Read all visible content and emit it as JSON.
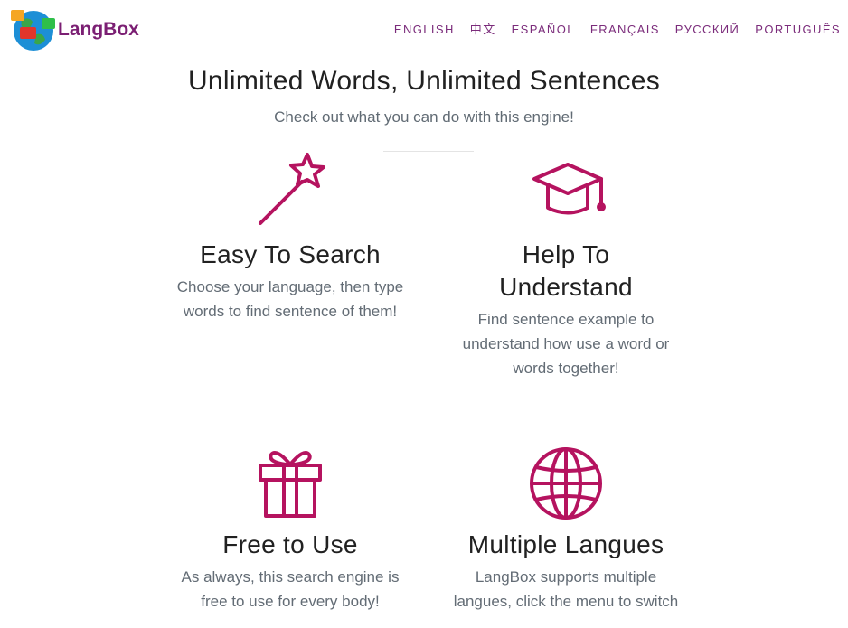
{
  "brand": {
    "name": "LangBox",
    "logo_icon": "globe-chat-bubbles-logo"
  },
  "nav": {
    "languages": [
      "ENGLISH",
      "中文",
      "ESPAÑOL",
      "FRANÇAIS",
      "РУССКИЙ",
      "PORTUGUÊS"
    ]
  },
  "section": {
    "title": "Unlimited Words, Unlimited Sentences",
    "subtitle": "Check out what you can do with this engine!"
  },
  "colors": {
    "accent": "#b5135f",
    "brand": "#7b1f73",
    "text": "#212121",
    "muted": "#636c75"
  },
  "features": [
    {
      "icon": "magic-wand-icon",
      "title": "Easy To Search",
      "text_lines": [
        "Choose your language, then type",
        "words to find sentence of them!"
      ]
    },
    {
      "icon": "graduation-cap-icon",
      "title_lines": [
        "Help To",
        "Understand"
      ],
      "text_lines": [
        "Find sentence example to",
        "understand how use a word or",
        "words together!"
      ]
    },
    {
      "icon": "gift-icon",
      "title": "Free to Use",
      "text_lines": [
        "As always, this search engine is",
        "free to use for every body!"
      ]
    },
    {
      "icon": "globe-icon",
      "title": "Multiple Langues",
      "text_lines": [
        "LangBox supports multiple",
        "langues, click the menu to switch"
      ]
    }
  ]
}
